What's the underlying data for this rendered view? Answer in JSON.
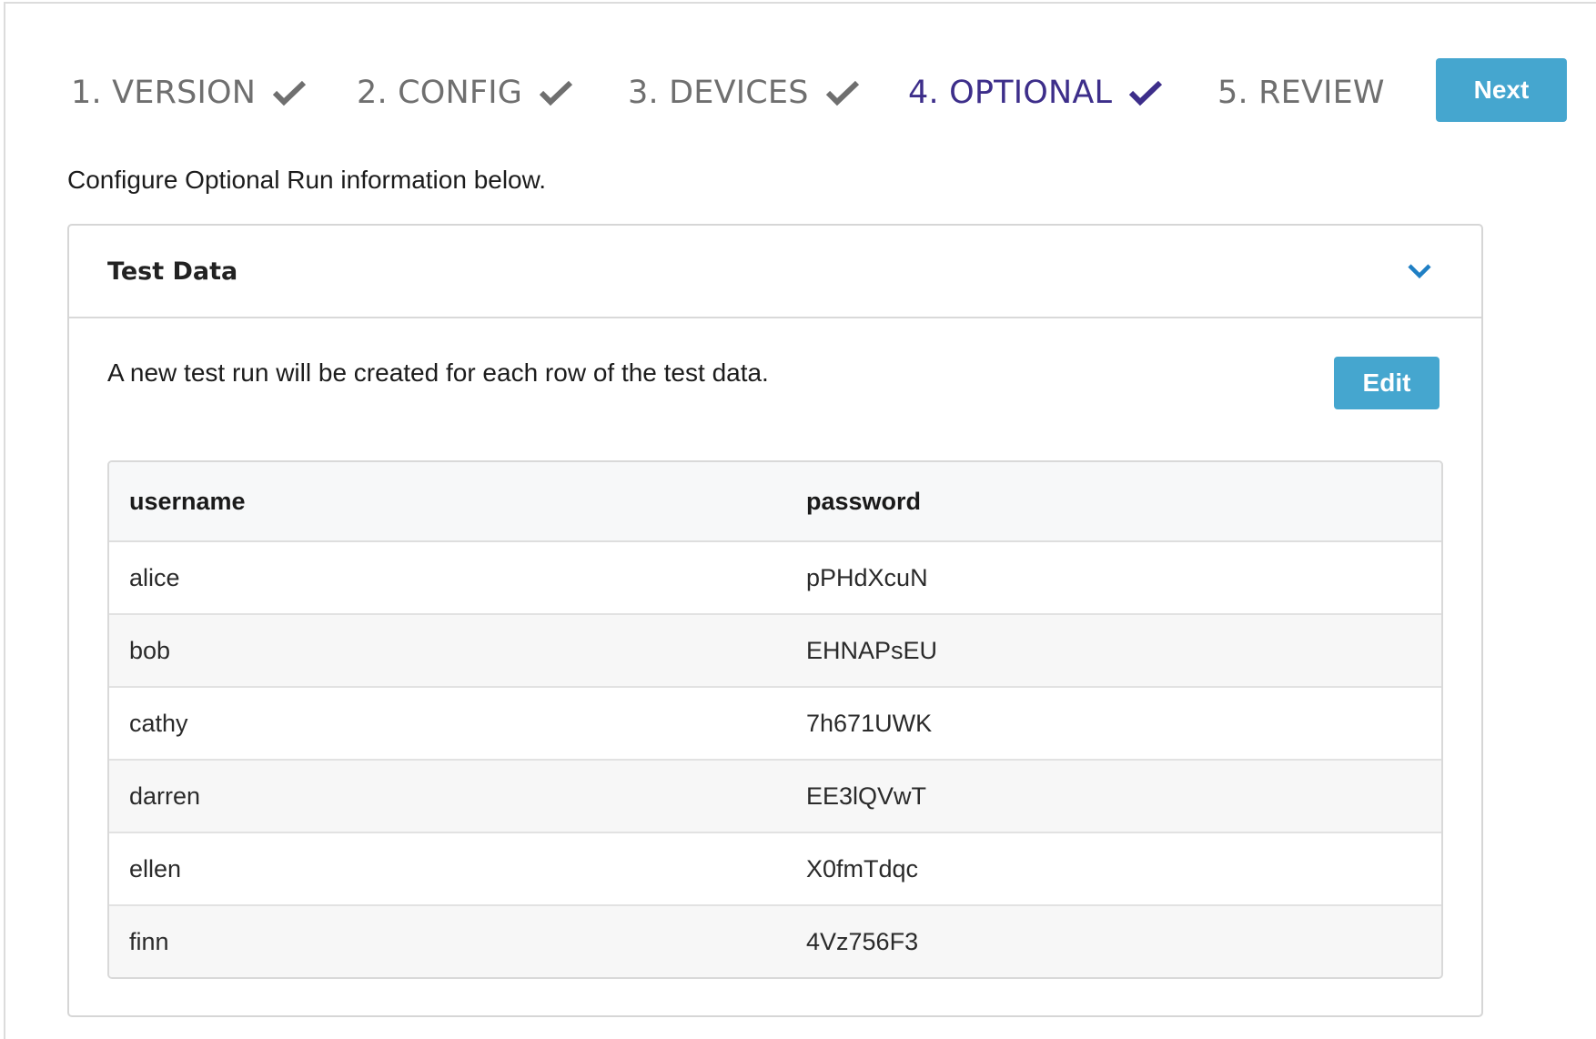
{
  "stepper": {
    "steps": [
      {
        "label": "1. VERSION",
        "completed": true,
        "active": false
      },
      {
        "label": "2. CONFIG",
        "completed": true,
        "active": false
      },
      {
        "label": "3. DEVICES",
        "completed": true,
        "active": false
      },
      {
        "label": "4. OPTIONAL",
        "completed": true,
        "active": true
      },
      {
        "label": "5. REVIEW",
        "completed": false,
        "active": false
      }
    ],
    "next_label": "Next",
    "colors": {
      "inactive": "#6f6f6f",
      "active": "#3d2e8a",
      "button": "#45a6cf"
    }
  },
  "intro_text": "Configure Optional Run information below.",
  "test_data_panel": {
    "title": "Test Data",
    "expanded": true,
    "toggle_icon": "chevron-down-icon",
    "description": "A new test run will be created for each row of the test data.",
    "edit_label": "Edit",
    "table": {
      "columns": [
        "username",
        "password"
      ],
      "rows": [
        [
          "alice",
          "pPHdXcuN"
        ],
        [
          "bob",
          "EHNAPsEU"
        ],
        [
          "cathy",
          "7h671UWK"
        ],
        [
          "darren",
          "EE3lQVwT"
        ],
        [
          "ellen",
          "X0fmTdqc"
        ],
        [
          "finn",
          "4Vz756F3"
        ]
      ]
    }
  }
}
